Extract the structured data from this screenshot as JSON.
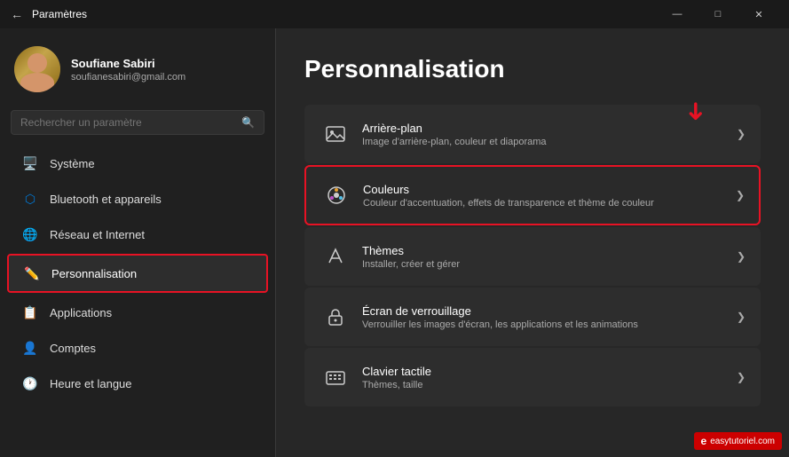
{
  "titlebar": {
    "back_label": "←",
    "title": "Paramètres",
    "minimize": "—",
    "maximize": "□",
    "close": "✕"
  },
  "sidebar": {
    "search_placeholder": "Rechercher un paramètre",
    "user": {
      "name": "Soufiane Sabiri",
      "email": "soufianesabiri@gmail.com"
    },
    "nav_items": [
      {
        "id": "system",
        "label": "Système",
        "icon": "💻"
      },
      {
        "id": "bluetooth",
        "label": "Bluetooth et appareils",
        "icon": "🔷"
      },
      {
        "id": "network",
        "label": "Réseau et Internet",
        "icon": "🌐"
      },
      {
        "id": "personalization",
        "label": "Personnalisation",
        "icon": "✏️",
        "active": true
      },
      {
        "id": "apps",
        "label": "Applications",
        "icon": "📦"
      },
      {
        "id": "accounts",
        "label": "Comptes",
        "icon": "👤"
      },
      {
        "id": "time",
        "label": "Heure et langue",
        "icon": "🕐"
      }
    ]
  },
  "main": {
    "title": "Personnalisation",
    "items": [
      {
        "id": "background",
        "name": "Arrière-plan",
        "desc": "Image d'arrière-plan, couleur et diaporama",
        "icon": "🖼️",
        "highlighted": false
      },
      {
        "id": "colors",
        "name": "Couleurs",
        "desc": "Couleur d'accentuation, effets de transparence et thème de couleur",
        "icon": "🎨",
        "highlighted": true
      },
      {
        "id": "themes",
        "name": "Thèmes",
        "desc": "Installer, créer et gérer",
        "icon": "🖌️",
        "highlighted": false
      },
      {
        "id": "lockscreen",
        "name": "Écran de verrouillage",
        "desc": "Verrouiller les images d'écran, les applications et les animations",
        "icon": "🔒",
        "highlighted": false
      },
      {
        "id": "touch",
        "name": "Clavier tactile",
        "desc": "Thèmes, taille",
        "icon": "⌨️",
        "highlighted": false
      }
    ]
  },
  "watermark": {
    "prefix": "e",
    "text": "easytutoriel.com"
  }
}
